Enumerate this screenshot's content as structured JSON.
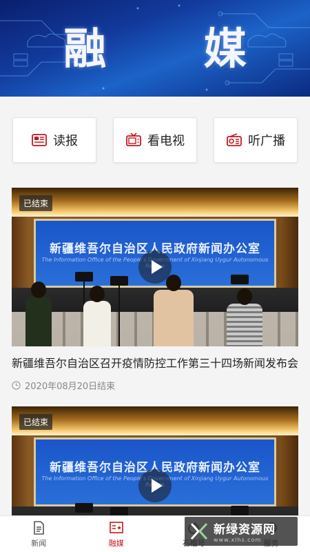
{
  "banner": {
    "title": "融 媒"
  },
  "actions": [
    {
      "label": "读报",
      "icon": "newspaper-icon"
    },
    {
      "label": "看电视",
      "icon": "tv-icon"
    },
    {
      "label": "听广播",
      "icon": "radio-icon"
    }
  ],
  "feed": [
    {
      "badge": "已结束",
      "screen_cn": "新疆维吾尔自治区人民政府新闻办公室",
      "screen_en": "The Information Office of the People's Government of Xinjiang Uygur Autonomous Region",
      "title": "新疆维吾尔自治区召开疫情防控工作第三十四场新闻发布会",
      "meta": "2020年08月20日结束"
    },
    {
      "badge": "已结束",
      "screen_cn": "新疆维吾尔自治区人民政府新闻办公室",
      "screen_en": "The Information Office of the People's Government of Xinjiang Uygur Autonomous Region"
    }
  ],
  "tabs": [
    {
      "label": "新闻",
      "icon": "document-icon"
    },
    {
      "label": "融媒",
      "icon": "media-icon",
      "active": true
    },
    {
      "label": "石榴号",
      "icon": "pomegranate-icon"
    },
    {
      "label": "服务",
      "icon": "service-icon"
    }
  ],
  "watermark": {
    "cn": "新绿资源网",
    "url": "www.xlhs.com"
  },
  "colors": {
    "accent": "#c8161d",
    "banner": "#123a9c"
  }
}
